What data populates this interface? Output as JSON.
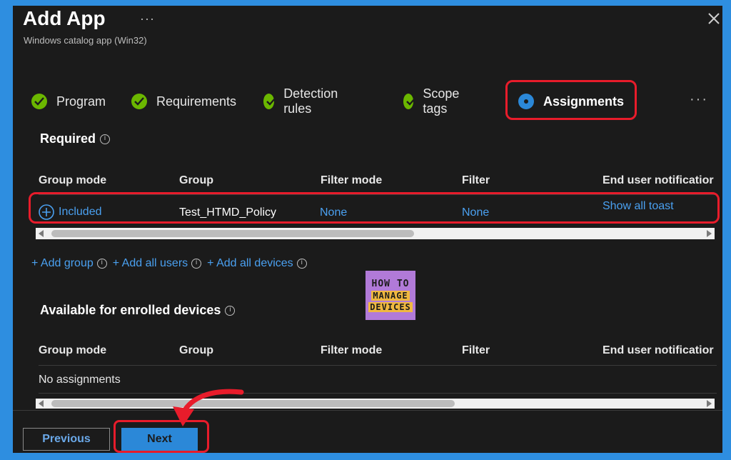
{
  "header": {
    "title": "Add App",
    "subtitle": "Windows catalog app (Win32)",
    "more": "···"
  },
  "steps": [
    {
      "label": "Program",
      "state": "done"
    },
    {
      "label": "Requirements",
      "state": "done"
    },
    {
      "label": "Detection rules",
      "state": "done"
    },
    {
      "label": "Scope tags",
      "state": "done"
    },
    {
      "label": "Assignments",
      "state": "active"
    }
  ],
  "steps_more": "···",
  "required": {
    "heading": "Required",
    "columns": [
      "Group mode",
      "Group",
      "Filter mode",
      "Filter",
      "End user notificatior"
    ],
    "row": {
      "group_mode": "Included",
      "group": "Test_HTMD_Policy",
      "filter_mode": "None",
      "filter": "None",
      "notification": "Show all toast"
    },
    "add_links": [
      "+ Add group",
      "+ Add all users",
      "+ Add all devices"
    ]
  },
  "available": {
    "heading": "Available for enrolled devices",
    "columns": [
      "Group mode",
      "Group",
      "Filter mode",
      "Filter",
      "End user notificatior"
    ],
    "empty": "No assignments"
  },
  "logo": {
    "line1": "HOW TO",
    "line2": "MANAGE",
    "line3": "DEVICES"
  },
  "buttons": {
    "previous": "Previous",
    "next": "Next"
  },
  "colors": {
    "accent": "#2b88d8",
    "check": "#6bb700",
    "highlight": "#e81c2b",
    "frame": "#2e8ee0"
  }
}
